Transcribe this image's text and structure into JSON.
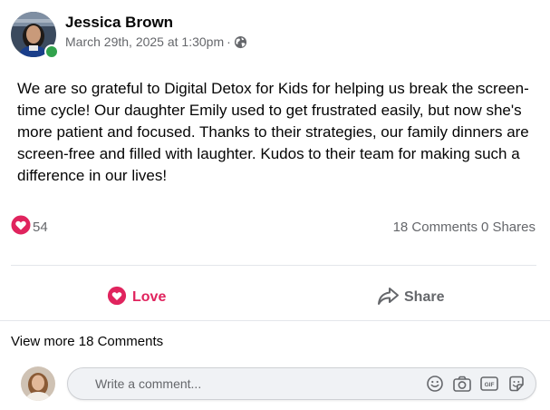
{
  "post": {
    "author": "Jessica Brown",
    "timestamp": "March 29th, 2025 at 1:30pm",
    "separator": "·",
    "visibility_icon": "globe-icon",
    "body": "We are so grateful to Digital Detox for Kids for helping us break the screen-time cycle! Our daughter Emily used to get frustrated easily, but now she's more patient and focused. Thanks to their strategies, our family dinners are screen-free and filled with laughter. Kudos to their team for making such a difference in our lives!"
  },
  "reactions": {
    "icon": "love-reaction-icon",
    "count": "54",
    "comments": "18 Comments",
    "shares": "0 Shares"
  },
  "actions": {
    "love_label": "Love",
    "share_label": "Share"
  },
  "comments": {
    "view_more": "View more 18 Comments",
    "placeholder": "Write a comment...",
    "tools": [
      "emoji-icon",
      "camera-icon",
      "gif-icon",
      "sticker-icon"
    ]
  },
  "colors": {
    "love": "#e0245e",
    "online": "#31a24c",
    "secondary_text": "#65676b",
    "input_bg": "#f0f2f5"
  }
}
